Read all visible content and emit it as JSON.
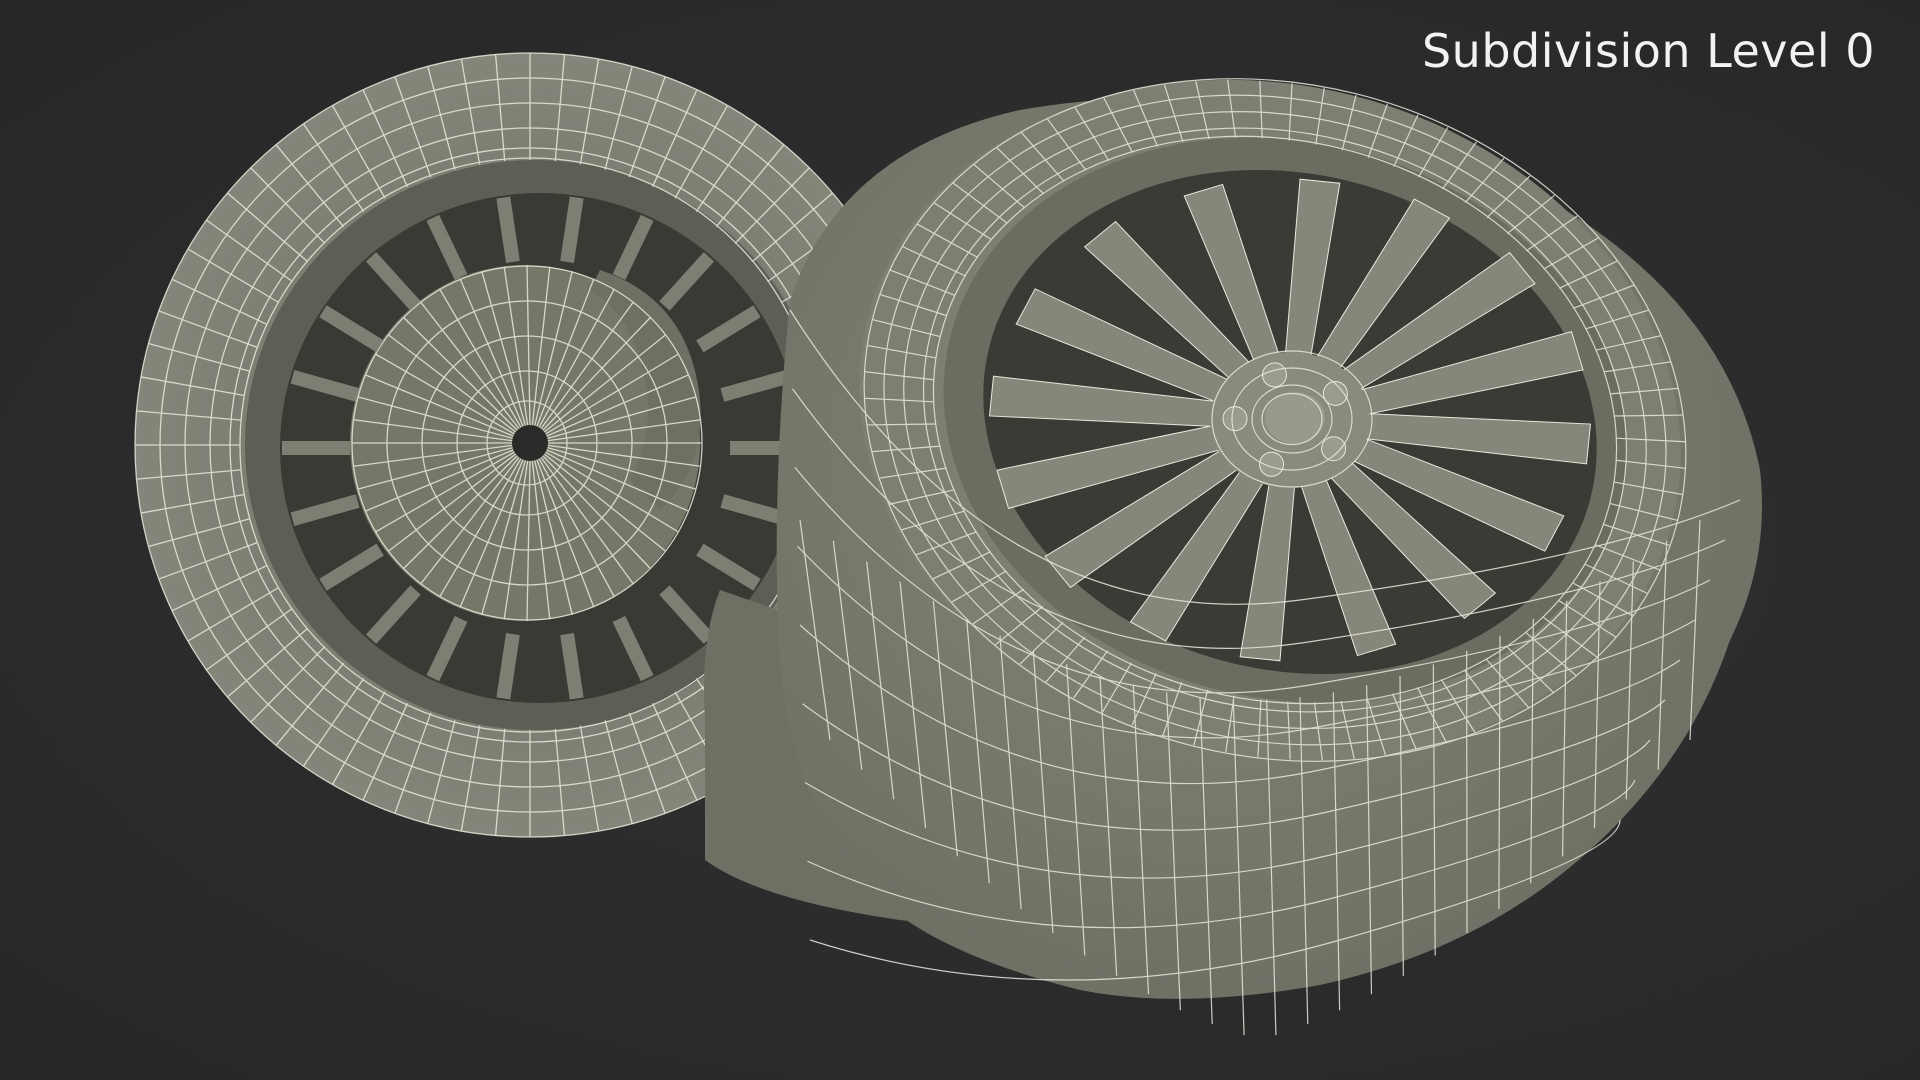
{
  "overlay": {
    "label": "Subdivision Level 0"
  },
  "scene": {
    "background_color": "#2b2b2b",
    "mesh_fill_color": "#7a7a6e",
    "wire_color": "#e8e8dc",
    "shadow_color": "#4a4a42",
    "objects": [
      "rear-wheel-with-brake",
      "front-wheel-with-alloy-rim"
    ]
  }
}
